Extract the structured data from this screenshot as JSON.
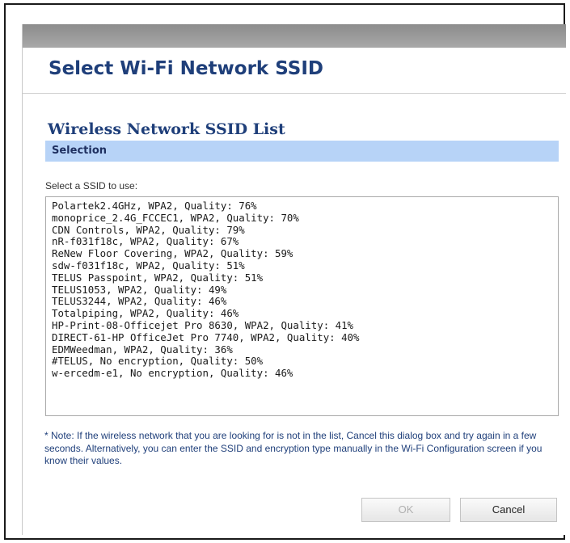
{
  "dialog": {
    "title": "Select Wi-Fi Network SSID"
  },
  "section": {
    "title": "Wireless Network SSID List",
    "selection_label": "Selection",
    "prompt": "Select a SSID to use:"
  },
  "ssid_list": [
    "Polartek2.4GHz, WPA2, Quality: 76%",
    "monoprice_2.4G_FCCEC1, WPA2, Quality: 70%",
    "CDN Controls, WPA2, Quality: 79%",
    "nR-f031f18c, WPA2, Quality: 67%",
    "ReNew Floor Covering, WPA2, Quality: 59%",
    "sdw-f031f18c, WPA2, Quality: 51%",
    "TELUS Passpoint, WPA2, Quality: 51%",
    "TELUS1053, WPA2, Quality: 49%",
    "TELUS3244, WPA2, Quality: 46%",
    "Totalpiping, WPA2, Quality: 46%",
    "HP-Print-08-Officejet Pro 8630, WPA2, Quality: 41%",
    "DIRECT-61-HP OfficeJet Pro 7740, WPA2, Quality: 40%",
    "EDMWeedman, WPA2, Quality: 36%",
    "#TELUS, No encryption, Quality: 50%",
    "w-ercedm-e1, No encryption, Quality: 46%"
  ],
  "note": "* Note: If the wireless network that you are looking for is not in the list, Cancel this dialog box and try again in a few seconds. Alternatively, you can enter the SSID and encryption type manually in the Wi-Fi Configuration screen if you know their values.",
  "buttons": {
    "ok_label": "OK",
    "cancel_label": "Cancel"
  },
  "colors": {
    "title_text": "#1f3f7a",
    "selection_bar": "#b7d3f7",
    "title_bar": "#9a9a9a"
  }
}
